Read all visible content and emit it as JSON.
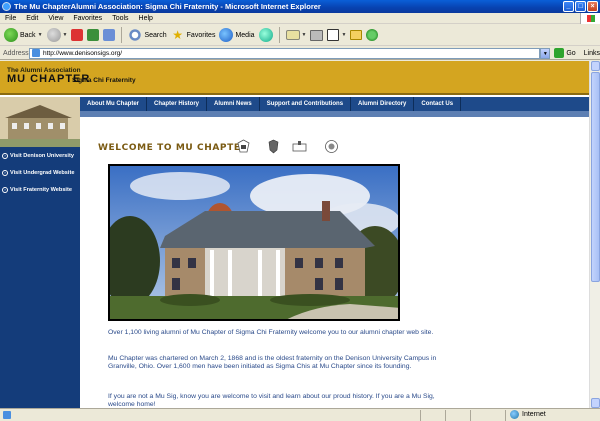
{
  "window": {
    "title": "The Mu ChapterAlumni Association: Sigma Chi Fraternity - Microsoft Internet Explorer"
  },
  "menu": [
    "File",
    "Edit",
    "View",
    "Favorites",
    "Tools",
    "Help"
  ],
  "toolbar": {
    "back_label": "Back",
    "search_label": "Search",
    "favorites_label": "Favorites",
    "media_label": "Media"
  },
  "address": {
    "label": "Address",
    "url": "http://www.denisonsigs.org/",
    "go_label": "Go",
    "links_label": "Links"
  },
  "site": {
    "association": "The Alumni Association",
    "chapter": "MU CHAPTER",
    "fraternity": "Sigma Chi Fraternity"
  },
  "nav": [
    "About Mu Chapter",
    "Chapter History",
    "Alumni News",
    "Support and Contributions",
    "Alumni Directory",
    "Contact Us"
  ],
  "sidebar": [
    "Visit Denison University",
    "Visit Undergrad Website",
    "Visit Fraternity Website"
  ],
  "main": {
    "heading": "WELCOME TO MU CHAPTER",
    "paragraphs": [
      "Over 1,100 living alumni of Mu Chapter of Sigma Chi Fraternity welcome you to our alumni chapter web site.",
      "Mu Chapter was chartered on March 2, 1868 and is the oldest fraternity on the Denison University Campus in Granville, Ohio. Over 1,600 men have been initiated as Sigma Chis at Mu Chapter since its founding.",
      "If you are not a Mu Sig, know you are welcome to visit and learn about our proud history. If you are a Mu Sig, welcome home!"
    ]
  },
  "status": {
    "zone": "Internet"
  },
  "colors": {
    "header_gold": "#d4a520",
    "nav_blue": "#1e4a8a",
    "sidebar_blue": "#143c7a",
    "heading_brown": "#7a5a12",
    "body_text_blue": "#2a4a8a"
  }
}
